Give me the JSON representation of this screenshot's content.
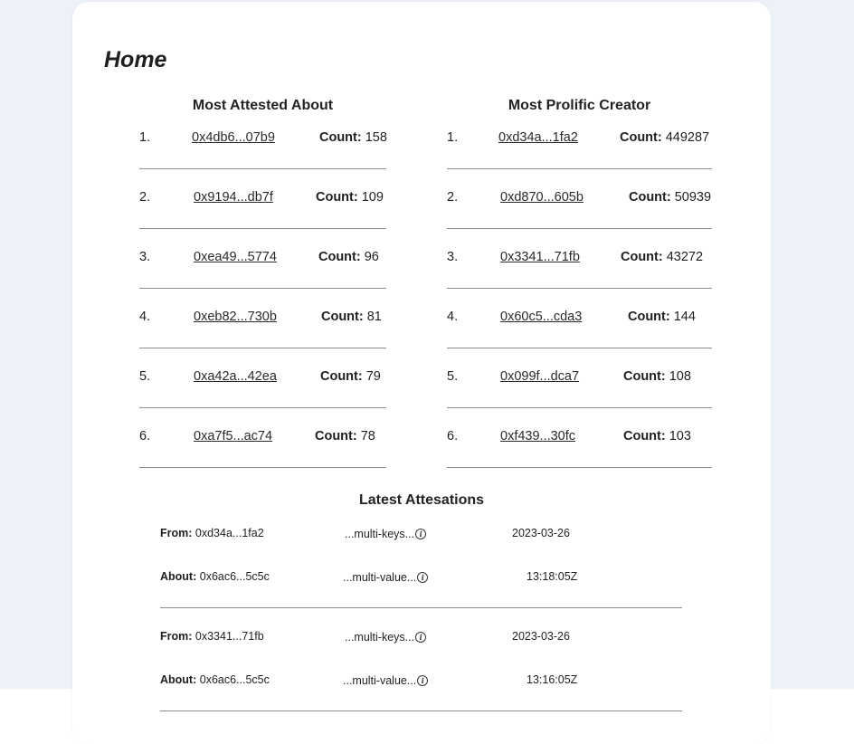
{
  "page": {
    "title": "Home"
  },
  "most_attested": {
    "title": "Most Attested About",
    "count_label": "Count:",
    "items": [
      {
        "rank": "1.",
        "address": "0x4db6...07b9",
        "count": "158"
      },
      {
        "rank": "2.",
        "address": "0x9194...db7f",
        "count": "109"
      },
      {
        "rank": "3.",
        "address": "0xea49...5774",
        "count": "96"
      },
      {
        "rank": "4.",
        "address": "0xeb82...730b",
        "count": "81"
      },
      {
        "rank": "5.",
        "address": "0xa42a...42ea",
        "count": "79"
      },
      {
        "rank": "6.",
        "address": "0xa7f5...ac74",
        "count": "78"
      }
    ]
  },
  "most_prolific": {
    "title": "Most Prolific Creator",
    "count_label": "Count:",
    "items": [
      {
        "rank": "1.",
        "address": "0xd34a...1fa2",
        "count": "449287"
      },
      {
        "rank": "2.",
        "address": "0xd870...605b",
        "count": "50939"
      },
      {
        "rank": "3.",
        "address": "0x3341...71fb",
        "count": "43272"
      },
      {
        "rank": "4.",
        "address": "0x60c5...cda3",
        "count": "144"
      },
      {
        "rank": "5.",
        "address": "0x099f...dca7",
        "count": "108"
      },
      {
        "rank": "6.",
        "address": "0xf439...30fc",
        "count": "103"
      }
    ]
  },
  "latest": {
    "title": "Latest Attesations",
    "from_label": "From:",
    "about_label": "About:",
    "items": [
      {
        "from": "0xd34a...1fa2",
        "about": "0x6ac6...5c5c",
        "keys": "...multi-keys...",
        "values": "...multi-value...",
        "date": "2023-03-26",
        "time": "13:18:05Z"
      },
      {
        "from": "0x3341...71fb",
        "about": "0x6ac6...5c5c",
        "keys": "...multi-keys...",
        "values": "...multi-value...",
        "date": "2023-03-26",
        "time": "13:16:05Z"
      }
    ]
  },
  "icons": {
    "info": "info-circle-icon"
  },
  "colors": {
    "page_bg": "#edf1f8",
    "card_bg": "#ffffff",
    "divider": "#8d8d8d",
    "text": "#1f1f1f"
  }
}
